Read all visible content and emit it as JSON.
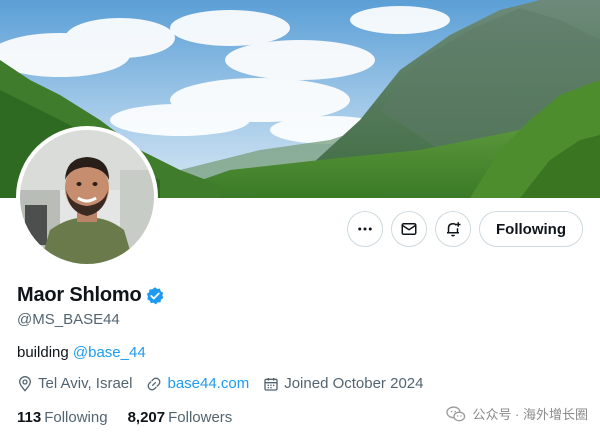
{
  "profile": {
    "display_name": "Maor Shlomo",
    "verified": true,
    "handle": "@MS_BASE44",
    "bio_text": "building ",
    "bio_mention": "@base_44",
    "location": "Tel Aviv, Israel",
    "website": "base44.com",
    "joined": "Joined October 2024",
    "following_count": "113",
    "following_label": "Following",
    "followers_count": "8,207",
    "followers_label": "Followers"
  },
  "actions": {
    "more_icon": "more-horizontal-icon",
    "message_icon": "envelope-icon",
    "notify_icon": "bell-plus-icon",
    "follow_label": "Following"
  },
  "watermark": {
    "text": "公众号 · 海外增长圈"
  },
  "colors": {
    "accent": "#1d9bf0",
    "text_primary": "#0f1419",
    "text_secondary": "#536471",
    "border": "#cfd9de"
  }
}
